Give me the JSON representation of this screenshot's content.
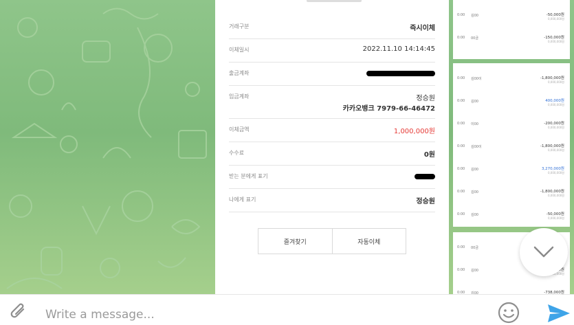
{
  "receipt": {
    "rows": [
      {
        "label": "거래구분",
        "value": "즉시이체"
      },
      {
        "label": "이체일시",
        "value": "2022.11.10 14:14:45"
      },
      {
        "label": "출금계좌",
        "value": ""
      },
      {
        "label": "입금계좌",
        "value_line1": "정승원",
        "value_line2": "카카오뱅크 7979-66-46472"
      },
      {
        "label": "이체금액",
        "value": "1,000,000원"
      },
      {
        "label": "수수료",
        "value": "0원"
      },
      {
        "label": "받는 분에게 표기",
        "value": ""
      },
      {
        "label": "나에게 표기",
        "value": "정승원"
      }
    ],
    "buttons": {
      "favorite": "즐겨찾기",
      "auto_transfer": "자동이체"
    },
    "amount_color": "#e53935"
  },
  "history": {
    "panel_top": [
      {
        "time": "0:00",
        "desc": "김00",
        "amount": "-50,000원",
        "sub": "0,000,000원"
      },
      {
        "time": "0:00",
        "desc": "00금",
        "amount": "-150,000원",
        "sub": "0,000,000원"
      }
    ],
    "panel_mid": [
      {
        "time": "0:00",
        "desc": "김00이",
        "amount": "-1,800,000원",
        "sub": "0,000,000원",
        "blue": false
      },
      {
        "time": "0:00",
        "desc": "김00",
        "amount": "400,000원",
        "sub": "0,000,000원",
        "blue": true
      },
      {
        "time": "0:00",
        "desc": "이00",
        "amount": "-200,000원",
        "sub": "0,000,000원",
        "blue": false
      },
      {
        "time": "0:00",
        "desc": "김00이",
        "amount": "-1,800,000원",
        "sub": "0,000,000원",
        "blue": false
      },
      {
        "time": "0:00",
        "desc": "김00",
        "amount": "3,270,000원",
        "sub": "0,000,000원",
        "blue": true
      },
      {
        "time": "0:00",
        "desc": "김00",
        "amount": "-1,800,000원",
        "sub": "0,000,000원",
        "blue": false
      },
      {
        "time": "0:00",
        "desc": "김00",
        "amount": "-50,000원",
        "sub": "0,000,000원",
        "blue": false
      }
    ],
    "panel_bottom": [
      {
        "time": "0:00",
        "desc": "00금",
        "amount": "-1,000,000원",
        "sub": "0,000,000원"
      },
      {
        "time": "0:00",
        "desc": "김00",
        "amount": "-1,000,000원",
        "sub": "0,000,000원"
      },
      {
        "time": "0:00",
        "desc": "김00",
        "amount": "-738,000원",
        "sub": "0,000,000원"
      }
    ]
  },
  "composer": {
    "placeholder": "Write a message...",
    "attach_icon": "paperclip-icon",
    "emoji_icon": "smiley-icon",
    "send_icon": "send-icon"
  },
  "scroll_icon": "chevron-down-icon",
  "colors": {
    "chat_bg": "#8fc58a",
    "send_blue": "#3ea4e8",
    "blue_amount": "#2f6fd6"
  }
}
